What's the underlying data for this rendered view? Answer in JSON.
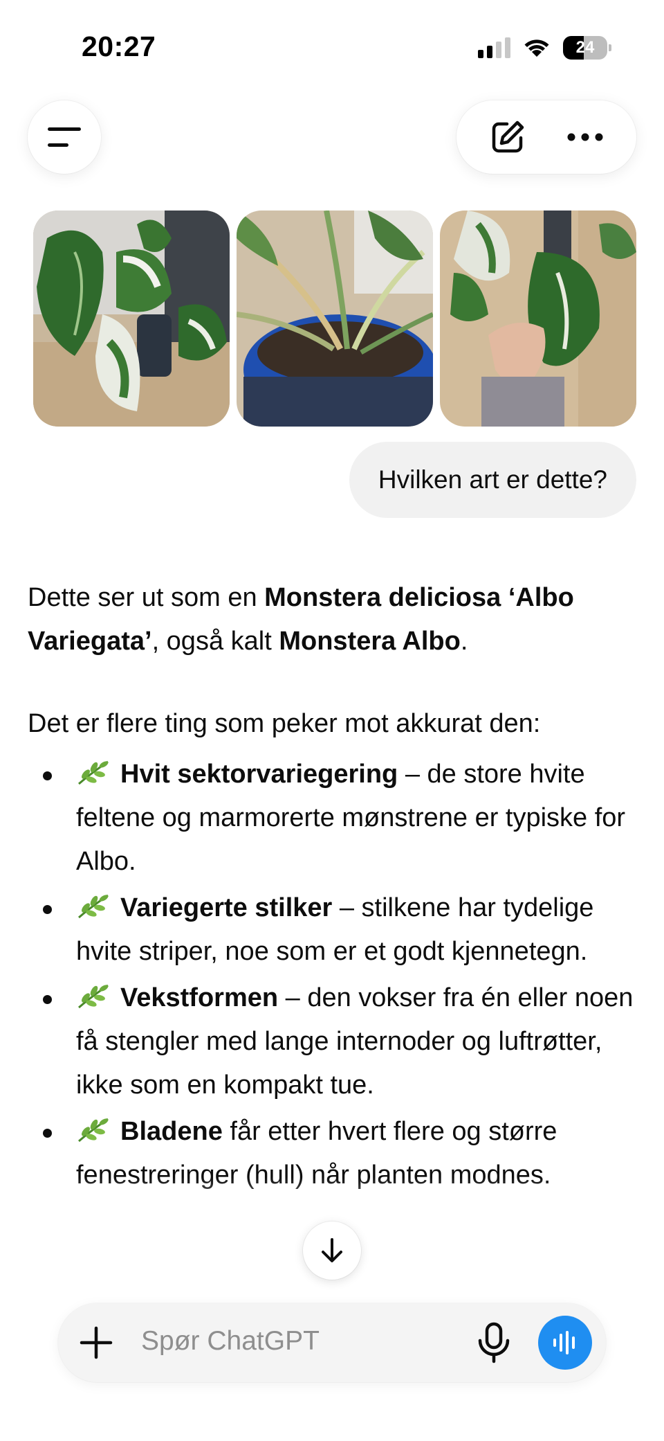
{
  "status_bar": {
    "time": "20:27",
    "battery_level": "24"
  },
  "header": {
    "icons": [
      "sidebar-menu-icon",
      "new-chat-icon",
      "more-icon"
    ]
  },
  "conversation": {
    "images": [
      "monstera-photo-1",
      "monstera-photo-2",
      "monstera-photo-3"
    ],
    "user_message": "Hvilken art er dette?",
    "assistant": {
      "intro": {
        "t1": "Dette ser ut som en ",
        "b1": "Monstera deliciosa ‘Albo Variegata’",
        "t2": ", også kalt ",
        "b2": "Monstera Albo",
        "t3": "."
      },
      "lead": "Det er flere ting som peker mot akkurat den:",
      "bullets": [
        {
          "icon": "🌿",
          "bold": "Hvit sektorvariegering",
          "text": " – de store hvite feltene og marmorerte mønstrene er typiske for Albo."
        },
        {
          "icon": "🌿",
          "bold": "Variegerte stilker",
          "text": " – stilkene har tydelige hvite striper, noe som er et godt kjennetegn."
        },
        {
          "icon": "🌿",
          "bold": "Vekstformen",
          "text": " – den vokser fra én eller noen få stengler med lange internoder og luftrøtter, ikke som en kompakt tue."
        },
        {
          "icon": "🌿",
          "bold": "Bladene",
          "text": " får etter hvert flere og større fenestreringer (hull) når planten modnes."
        }
      ]
    }
  },
  "composer": {
    "placeholder": "Spør ChatGPT"
  },
  "colors": {
    "accent": "#1f8ef1",
    "bubble": "#f1f1f1",
    "text": "#0d0d0d",
    "placeholder": "#8e8e8e"
  }
}
